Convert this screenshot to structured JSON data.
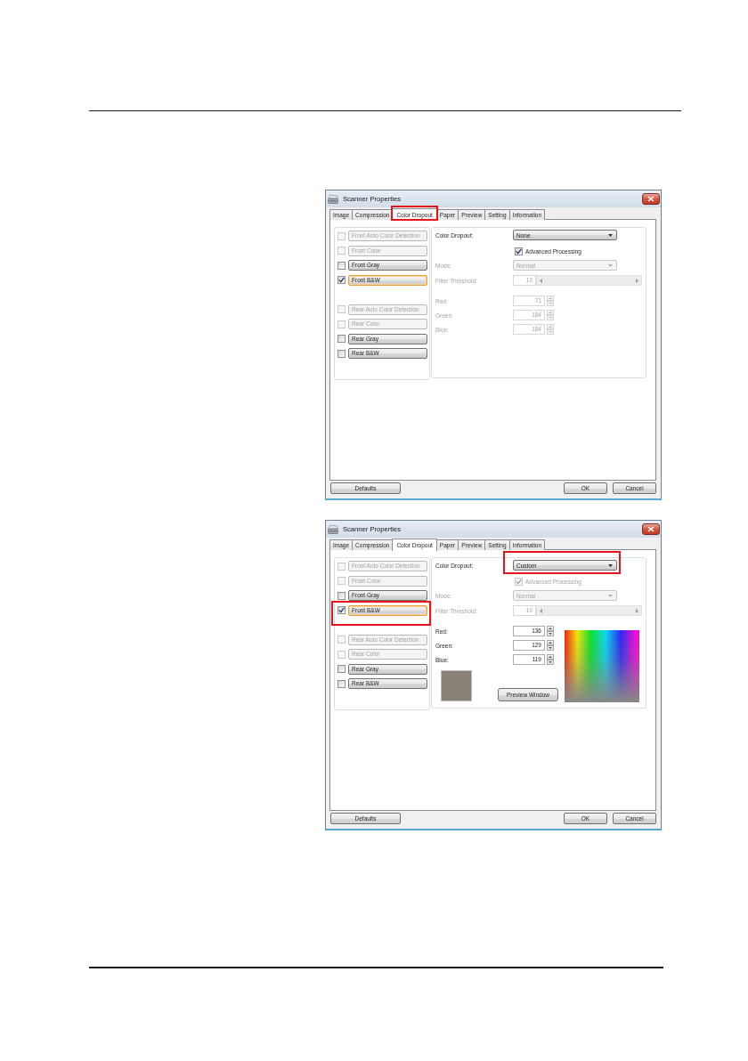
{
  "dialogs": [
    {
      "title": "Scanner Properties",
      "tabs": [
        {
          "label": "Image",
          "selected": false,
          "highlighted": false
        },
        {
          "label": "Compression",
          "selected": false,
          "highlighted": false
        },
        {
          "label": "Color Dropout",
          "selected": true,
          "highlighted": true
        },
        {
          "label": "Paper",
          "selected": false,
          "highlighted": false
        },
        {
          "label": "Preview",
          "selected": false,
          "highlighted": false
        },
        {
          "label": "Setting",
          "selected": false,
          "highlighted": false
        },
        {
          "label": "Information",
          "selected": false,
          "highlighted": false
        }
      ],
      "image_type_groups": [
        {
          "items": [
            {
              "label": "Front Auto Color Detection",
              "checked": false,
              "disabled": true,
              "selected": false,
              "highlighted": false
            },
            {
              "label": "Front Color",
              "checked": false,
              "disabled": true,
              "selected": false,
              "highlighted": false
            },
            {
              "label": "Front Gray",
              "checked": false,
              "disabled": false,
              "selected": false,
              "highlighted": false
            },
            {
              "label": "Front B&W",
              "checked": true,
              "disabled": false,
              "selected": true,
              "highlighted": false
            }
          ]
        },
        {
          "items": [
            {
              "label": "Rear Auto Color Detection",
              "checked": false,
              "disabled": true,
              "selected": false,
              "highlighted": false
            },
            {
              "label": "Rear Color",
              "checked": false,
              "disabled": true,
              "selected": false,
              "highlighted": false
            },
            {
              "label": "Rear Gray",
              "checked": false,
              "disabled": false,
              "selected": false,
              "highlighted": false
            },
            {
              "label": "Rear B&W",
              "checked": false,
              "disabled": false,
              "selected": false,
              "highlighted": false
            }
          ]
        }
      ],
      "color_dropout": {
        "label": "Color Dropout:",
        "value": "None",
        "highlighted": false
      },
      "advanced_processing": {
        "label": "Advanced Processing",
        "checked": true,
        "disabled": false
      },
      "mode": {
        "label": "Mode:",
        "value": "Normal",
        "disabled": true
      },
      "filter_threshold": {
        "label": "Filter Threshold:",
        "value": "10",
        "disabled": true
      },
      "rgb": {
        "disabled": true,
        "channels": [
          {
            "label": "Red:",
            "value": "71"
          },
          {
            "label": "Green:",
            "value": "184"
          },
          {
            "label": "Blue:",
            "value": "184"
          }
        ]
      },
      "footer": {
        "left": [
          "Defaults"
        ],
        "right": [
          "OK",
          "Cancel"
        ]
      }
    },
    {
      "title": "Scanner Properties",
      "tabs": [
        {
          "label": "Image",
          "selected": false,
          "highlighted": false
        },
        {
          "label": "Compression",
          "selected": false,
          "highlighted": false
        },
        {
          "label": "Color Dropout",
          "selected": true,
          "highlighted": false
        },
        {
          "label": "Paper",
          "selected": false,
          "highlighted": false
        },
        {
          "label": "Preview",
          "selected": false,
          "highlighted": false
        },
        {
          "label": "Setting",
          "selected": false,
          "highlighted": false
        },
        {
          "label": "Information",
          "selected": false,
          "highlighted": false
        }
      ],
      "image_type_groups": [
        {
          "items": [
            {
              "label": "Front Auto Color Detection",
              "checked": false,
              "disabled": true,
              "selected": false,
              "highlighted": false
            },
            {
              "label": "Front Color",
              "checked": false,
              "disabled": true,
              "selected": false,
              "highlighted": false
            },
            {
              "label": "Front Gray",
              "checked": false,
              "disabled": false,
              "selected": false,
              "highlighted": false
            },
            {
              "label": "Front B&W",
              "checked": true,
              "disabled": false,
              "selected": true,
              "highlighted": true
            }
          ]
        },
        {
          "items": [
            {
              "label": "Rear Auto Color Detection",
              "checked": false,
              "disabled": true,
              "selected": false,
              "highlighted": false
            },
            {
              "label": "Rear Color",
              "checked": false,
              "disabled": true,
              "selected": false,
              "highlighted": false
            },
            {
              "label": "Rear Gray",
              "checked": false,
              "disabled": false,
              "selected": false,
              "highlighted": false
            },
            {
              "label": "Rear B&W",
              "checked": false,
              "disabled": false,
              "selected": false,
              "highlighted": false
            }
          ]
        }
      ],
      "color_dropout": {
        "label": "Color Dropout:",
        "value": "Custom",
        "highlighted": true
      },
      "advanced_processing": {
        "label": "Advanced Processing",
        "checked": true,
        "disabled": true
      },
      "mode": {
        "label": "Mode:",
        "value": "Normal",
        "disabled": true
      },
      "filter_threshold": {
        "label": "Filter Threshold:",
        "value": "10",
        "disabled": true
      },
      "rgb": {
        "disabled": false,
        "channels": [
          {
            "label": "Red:",
            "value": "136"
          },
          {
            "label": "Green:",
            "value": "129"
          },
          {
            "label": "Blue:",
            "value": "119"
          }
        ]
      },
      "color_picker": {
        "button": "Preview Window"
      },
      "footer": {
        "left": [
          "Defaults"
        ],
        "right": [
          "OK",
          "Cancel"
        ]
      }
    }
  ]
}
